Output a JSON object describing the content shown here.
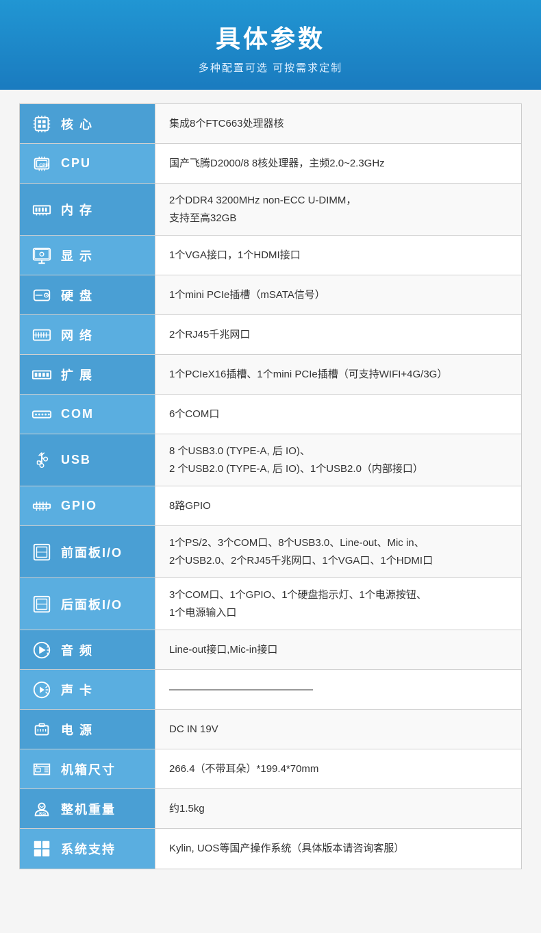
{
  "header": {
    "title": "具体参数",
    "subtitle": "多种配置可选 可按需求定制"
  },
  "specs": [
    {
      "id": "core",
      "label": "核 心",
      "icon": "cpu-grid",
      "value": "集成8个FTC663处理器核"
    },
    {
      "id": "cpu",
      "label": "CPU",
      "icon": "cpu",
      "value": "国产飞腾D2000/8  8核处理器，主频2.0~2.3GHz"
    },
    {
      "id": "memory",
      "label": "内 存",
      "icon": "ram",
      "value": "2个DDR4 3200MHz non-ECC U-DIMM，\n支持至高32GB"
    },
    {
      "id": "display",
      "label": "显 示",
      "icon": "monitor",
      "value": "1个VGA接口，1个HDMI接口"
    },
    {
      "id": "storage",
      "label": "硬 盘",
      "icon": "hdd",
      "value": "1个mini PCIe插槽（mSATA信号）"
    },
    {
      "id": "network",
      "label": "网 络",
      "icon": "network",
      "value": "2个RJ45千兆网口"
    },
    {
      "id": "expansion",
      "label": "扩 展",
      "icon": "pcie",
      "value": "1个PCIeX16插槽、1个mini PCIe插槽（可支持WIFI+4G/3G）"
    },
    {
      "id": "com",
      "label": "COM",
      "icon": "serial",
      "value": "6个COM口"
    },
    {
      "id": "usb",
      "label": "USB",
      "icon": "usb",
      "value": "8 个USB3.0 (TYPE-A, 后 IO)、\n2 个USB2.0 (TYPE-A, 后 IO)、1个USB2.0（内部接口）"
    },
    {
      "id": "gpio",
      "label": "GPIO",
      "icon": "gpio",
      "value": "8路GPIO"
    },
    {
      "id": "frontio",
      "label": "前面板I/O",
      "icon": "panel",
      "value": "1个PS/2、3个COM口、8个USB3.0、Line-out、Mic in、\n2个USB2.0、2个RJ45千兆网口、1个VGA口、1个HDMI口"
    },
    {
      "id": "reario",
      "label": "后面板I/O",
      "icon": "panel2",
      "value": "3个COM口、1个GPIO、1个硬盘指示灯、1个电源按钮、\n1个电源输入口"
    },
    {
      "id": "audio",
      "label": "音 频",
      "icon": "audio",
      "value": "Line-out接口,Mic-in接口"
    },
    {
      "id": "soundcard",
      "label": "声 卡",
      "icon": "soundcard",
      "value": "——————————————"
    },
    {
      "id": "power",
      "label": "电 源",
      "icon": "power",
      "value": "DC IN 19V"
    },
    {
      "id": "chassis",
      "label": "机箱尺寸",
      "icon": "chassis",
      "value": "266.4（不带耳朵）*199.4*70mm"
    },
    {
      "id": "weight",
      "label": "整机重量",
      "icon": "weight",
      "value": "约1.5kg"
    },
    {
      "id": "os",
      "label": "系统支持",
      "icon": "windows",
      "value": "Kylin, UOS等国产操作系统（具体版本请咨询客服）"
    }
  ]
}
